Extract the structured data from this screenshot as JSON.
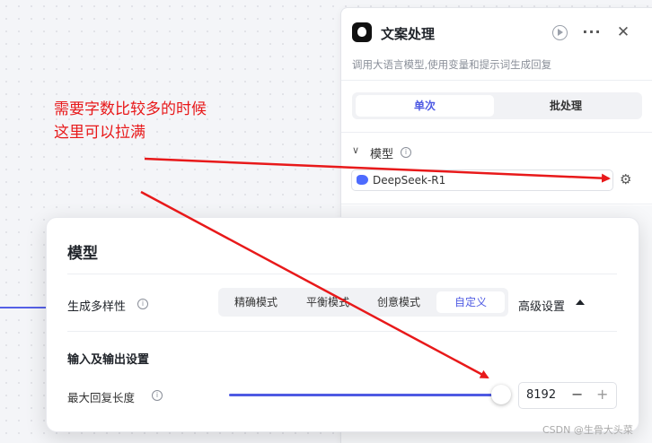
{
  "node": {
    "title": "文案处理",
    "description": "调用大语言模型,使用变量和提示词生成回复",
    "tabs": [
      "单次",
      "批处理"
    ],
    "model_section_title": "模型",
    "model_name": "DeepSeek-R1"
  },
  "settings": {
    "title": "模型",
    "diversity_label": "生成多样性",
    "modes": [
      "精确模式",
      "平衡模式",
      "创意模式",
      "自定义"
    ],
    "selected_mode": "自定义",
    "advanced_label": "高级设置",
    "io_title": "输入及输出设置",
    "max_length_label": "最大回复长度",
    "max_length_value": "8192",
    "max_length_fraction": 1.0
  },
  "annotation": {
    "line1": "需要字数比较多的时候",
    "line2": "这里可以拉满"
  },
  "watermark": "CSDN @生骨大头菜",
  "colors": {
    "accent": "#4e5ae3",
    "annotation": "#e8191a"
  },
  "icons": {
    "node": "robot-icon",
    "play": "play-icon",
    "more": "more-icon",
    "close": "close-icon",
    "chevron": "chevron-down-icon",
    "info": "info-icon",
    "model": "whale-icon",
    "gear": "gear-icon",
    "caret": "caret-up-icon"
  }
}
